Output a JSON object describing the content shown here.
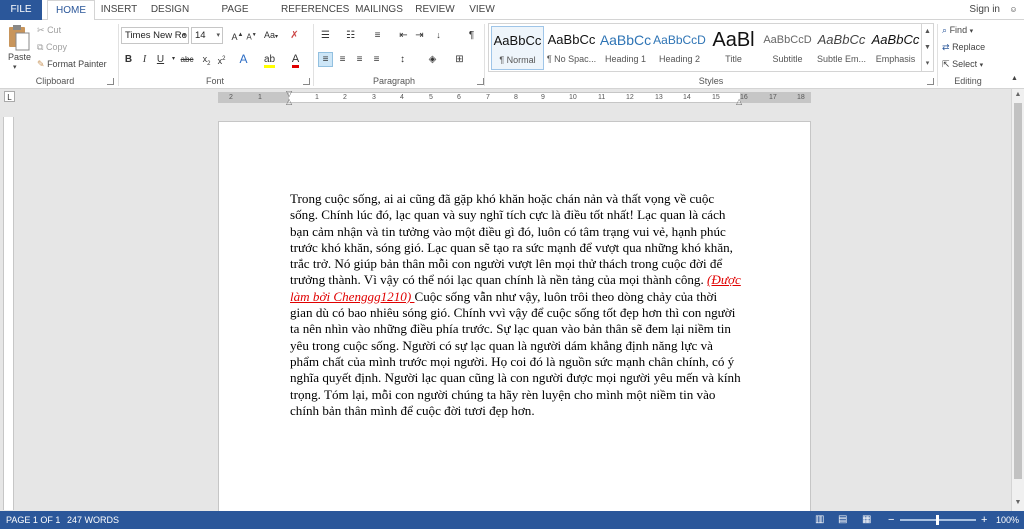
{
  "tabs": [
    "FILE",
    "HOME",
    "INSERT",
    "DESIGN",
    "PAGE LAYOUT",
    "REFERENCES",
    "MAILINGS",
    "REVIEW",
    "VIEW"
  ],
  "active_tab": "HOME",
  "sign_in": "Sign in",
  "clipboard": {
    "paste": "Paste",
    "cut": "Cut",
    "copy": "Copy",
    "format_painter": "Format Painter",
    "label": "Clipboard"
  },
  "font": {
    "family": "Times New Ro",
    "size": "14",
    "label": "Font",
    "case_button": "Aa"
  },
  "paragraph": {
    "label": "Paragraph"
  },
  "styles": {
    "label": "Styles",
    "items": [
      {
        "preview": "AaBbCc",
        "name": "¶ Normal"
      },
      {
        "preview": "AaBbCc",
        "name": "¶ No Spac..."
      },
      {
        "preview": "AaBbCc",
        "name": "Heading 1"
      },
      {
        "preview": "AaBbCcD",
        "name": "Heading 2"
      },
      {
        "preview": "AaBl",
        "name": "Title"
      },
      {
        "preview": "AaBbCcD",
        "name": "Subtitle"
      },
      {
        "preview": "AaBbCc",
        "name": "Subtle Em..."
      },
      {
        "preview": "AaBbCc",
        "name": "Emphasis"
      }
    ]
  },
  "editing": {
    "find": "Find",
    "replace": "Replace",
    "select": "Select",
    "label": "Editing"
  },
  "ruler_numbers": [
    "2",
    "1",
    "1",
    "2",
    "3",
    "4",
    "5",
    "6",
    "7",
    "8",
    "9",
    "10",
    "11",
    "12",
    "13",
    "14",
    "15",
    "16",
    "17",
    "18"
  ],
  "document": {
    "para_before": "Trong cuộc sống, ai ai cũng đã gặp khó khăn hoặc chán nản và thất vọng về cuộc sống. Chính lúc đó, lạc quan và suy nghĩ tích cực là điều tốt nhất! Lạc quan là cách bạn cảm nhận và tin tưởng vào một điều gì đó, luôn có tâm trạng vui vẻ, hạnh phúc trước khó khăn, sóng gió. Lạc quan sẽ tạo ra sức mạnh để vượt qua những khó khăn, trắc trở. Nó giúp bản thân mỗi con người vượt lên mọi thử thách trong cuộc đời để trưởng thành. Vì vậy có thể nói lạc quan chính là nền tảng của mọi thành công. ",
    "highlight": "(Được làm bởi Chenggg1210) ",
    "para_after": "Cuộc sống vẫn như vậy, luôn trôi theo dòng chảy của thời gian dù có bao nhiêu sóng gió. Chính vvì vậy để cuộc sống tốt đẹp hơn thì con người ta nên nhìn vào những điều phía trước. Sự lạc quan vào bản thân sẽ đem lại niềm tin yêu trong cuộc sống. Người có sự lạc quan là người dám khẳng định năng lực và phẩm chất của mình trước mọi người. Họ coi đó là nguồn sức mạnh chân chính, có ý nghĩa quyết định. Người  lạc quan cũng là con người được mọi người yêu mến và kính trọng. Tóm lại, mỗi con người chúng ta hãy rèn luyện cho mình một niềm tin vào chính bản thân mình để cuộc đời tươi đẹp hơn."
  },
  "status": {
    "page": "PAGE 1 OF 1",
    "words": "247 WORDS",
    "zoom": "100%"
  },
  "colors": {
    "brand": "#2b579a",
    "highlight_text": "#e00000"
  }
}
